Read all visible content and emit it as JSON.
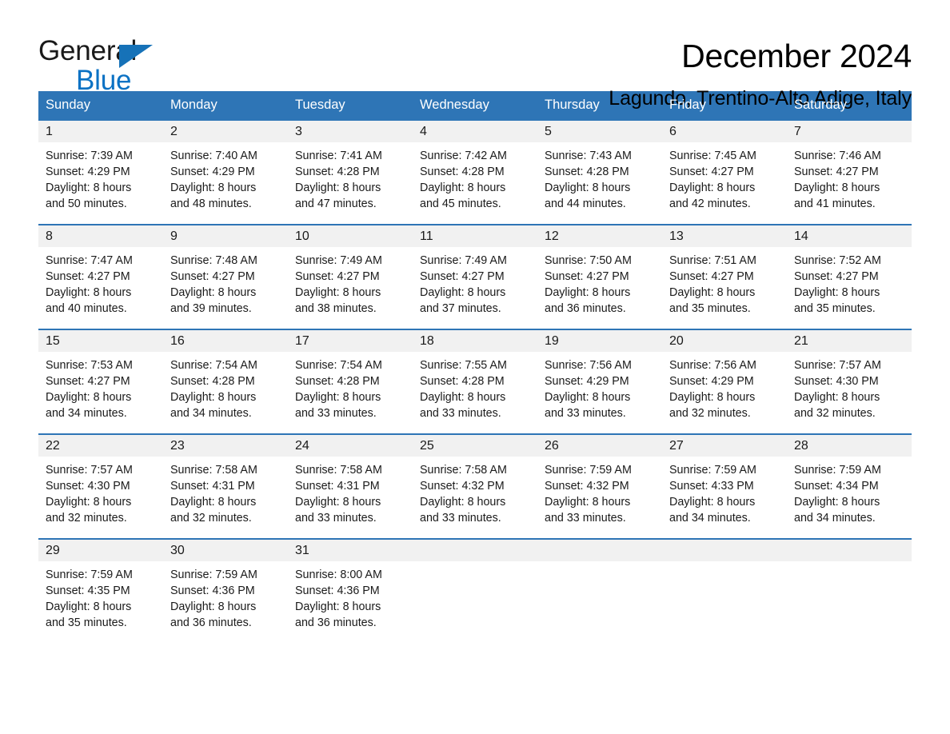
{
  "brand": {
    "name_part1": "General",
    "name_part2": "Blue",
    "triangle_color": "#1672b8",
    "blue_color": "#0b72c4"
  },
  "header": {
    "title": "December 2024",
    "subtitle": "Lagundo, Trentino-Alto Adige, Italy"
  },
  "colors": {
    "header_blue": "#2e75b6",
    "day_band_gray": "#f1f1f1",
    "text": "#1a1a1a"
  },
  "weekday_headers": [
    "Sunday",
    "Monday",
    "Tuesday",
    "Wednesday",
    "Thursday",
    "Friday",
    "Saturday"
  ],
  "weeks": [
    [
      {
        "day": "1",
        "sunrise": "Sunrise: 7:39 AM",
        "sunset": "Sunset: 4:29 PM",
        "daylight1": "Daylight: 8 hours",
        "daylight2": "and 50 minutes."
      },
      {
        "day": "2",
        "sunrise": "Sunrise: 7:40 AM",
        "sunset": "Sunset: 4:29 PM",
        "daylight1": "Daylight: 8 hours",
        "daylight2": "and 48 minutes."
      },
      {
        "day": "3",
        "sunrise": "Sunrise: 7:41 AM",
        "sunset": "Sunset: 4:28 PM",
        "daylight1": "Daylight: 8 hours",
        "daylight2": "and 47 minutes."
      },
      {
        "day": "4",
        "sunrise": "Sunrise: 7:42 AM",
        "sunset": "Sunset: 4:28 PM",
        "daylight1": "Daylight: 8 hours",
        "daylight2": "and 45 minutes."
      },
      {
        "day": "5",
        "sunrise": "Sunrise: 7:43 AM",
        "sunset": "Sunset: 4:28 PM",
        "daylight1": "Daylight: 8 hours",
        "daylight2": "and 44 minutes."
      },
      {
        "day": "6",
        "sunrise": "Sunrise: 7:45 AM",
        "sunset": "Sunset: 4:27 PM",
        "daylight1": "Daylight: 8 hours",
        "daylight2": "and 42 minutes."
      },
      {
        "day": "7",
        "sunrise": "Sunrise: 7:46 AM",
        "sunset": "Sunset: 4:27 PM",
        "daylight1": "Daylight: 8 hours",
        "daylight2": "and 41 minutes."
      }
    ],
    [
      {
        "day": "8",
        "sunrise": "Sunrise: 7:47 AM",
        "sunset": "Sunset: 4:27 PM",
        "daylight1": "Daylight: 8 hours",
        "daylight2": "and 40 minutes."
      },
      {
        "day": "9",
        "sunrise": "Sunrise: 7:48 AM",
        "sunset": "Sunset: 4:27 PM",
        "daylight1": "Daylight: 8 hours",
        "daylight2": "and 39 minutes."
      },
      {
        "day": "10",
        "sunrise": "Sunrise: 7:49 AM",
        "sunset": "Sunset: 4:27 PM",
        "daylight1": "Daylight: 8 hours",
        "daylight2": "and 38 minutes."
      },
      {
        "day": "11",
        "sunrise": "Sunrise: 7:49 AM",
        "sunset": "Sunset: 4:27 PM",
        "daylight1": "Daylight: 8 hours",
        "daylight2": "and 37 minutes."
      },
      {
        "day": "12",
        "sunrise": "Sunrise: 7:50 AM",
        "sunset": "Sunset: 4:27 PM",
        "daylight1": "Daylight: 8 hours",
        "daylight2": "and 36 minutes."
      },
      {
        "day": "13",
        "sunrise": "Sunrise: 7:51 AM",
        "sunset": "Sunset: 4:27 PM",
        "daylight1": "Daylight: 8 hours",
        "daylight2": "and 35 minutes."
      },
      {
        "day": "14",
        "sunrise": "Sunrise: 7:52 AM",
        "sunset": "Sunset: 4:27 PM",
        "daylight1": "Daylight: 8 hours",
        "daylight2": "and 35 minutes."
      }
    ],
    [
      {
        "day": "15",
        "sunrise": "Sunrise: 7:53 AM",
        "sunset": "Sunset: 4:27 PM",
        "daylight1": "Daylight: 8 hours",
        "daylight2": "and 34 minutes."
      },
      {
        "day": "16",
        "sunrise": "Sunrise: 7:54 AM",
        "sunset": "Sunset: 4:28 PM",
        "daylight1": "Daylight: 8 hours",
        "daylight2": "and 34 minutes."
      },
      {
        "day": "17",
        "sunrise": "Sunrise: 7:54 AM",
        "sunset": "Sunset: 4:28 PM",
        "daylight1": "Daylight: 8 hours",
        "daylight2": "and 33 minutes."
      },
      {
        "day": "18",
        "sunrise": "Sunrise: 7:55 AM",
        "sunset": "Sunset: 4:28 PM",
        "daylight1": "Daylight: 8 hours",
        "daylight2": "and 33 minutes."
      },
      {
        "day": "19",
        "sunrise": "Sunrise: 7:56 AM",
        "sunset": "Sunset: 4:29 PM",
        "daylight1": "Daylight: 8 hours",
        "daylight2": "and 33 minutes."
      },
      {
        "day": "20",
        "sunrise": "Sunrise: 7:56 AM",
        "sunset": "Sunset: 4:29 PM",
        "daylight1": "Daylight: 8 hours",
        "daylight2": "and 32 minutes."
      },
      {
        "day": "21",
        "sunrise": "Sunrise: 7:57 AM",
        "sunset": "Sunset: 4:30 PM",
        "daylight1": "Daylight: 8 hours",
        "daylight2": "and 32 minutes."
      }
    ],
    [
      {
        "day": "22",
        "sunrise": "Sunrise: 7:57 AM",
        "sunset": "Sunset: 4:30 PM",
        "daylight1": "Daylight: 8 hours",
        "daylight2": "and 32 minutes."
      },
      {
        "day": "23",
        "sunrise": "Sunrise: 7:58 AM",
        "sunset": "Sunset: 4:31 PM",
        "daylight1": "Daylight: 8 hours",
        "daylight2": "and 32 minutes."
      },
      {
        "day": "24",
        "sunrise": "Sunrise: 7:58 AM",
        "sunset": "Sunset: 4:31 PM",
        "daylight1": "Daylight: 8 hours",
        "daylight2": "and 33 minutes."
      },
      {
        "day": "25",
        "sunrise": "Sunrise: 7:58 AM",
        "sunset": "Sunset: 4:32 PM",
        "daylight1": "Daylight: 8 hours",
        "daylight2": "and 33 minutes."
      },
      {
        "day": "26",
        "sunrise": "Sunrise: 7:59 AM",
        "sunset": "Sunset: 4:32 PM",
        "daylight1": "Daylight: 8 hours",
        "daylight2": "and 33 minutes."
      },
      {
        "day": "27",
        "sunrise": "Sunrise: 7:59 AM",
        "sunset": "Sunset: 4:33 PM",
        "daylight1": "Daylight: 8 hours",
        "daylight2": "and 34 minutes."
      },
      {
        "day": "28",
        "sunrise": "Sunrise: 7:59 AM",
        "sunset": "Sunset: 4:34 PM",
        "daylight1": "Daylight: 8 hours",
        "daylight2": "and 34 minutes."
      }
    ],
    [
      {
        "day": "29",
        "sunrise": "Sunrise: 7:59 AM",
        "sunset": "Sunset: 4:35 PM",
        "daylight1": "Daylight: 8 hours",
        "daylight2": "and 35 minutes."
      },
      {
        "day": "30",
        "sunrise": "Sunrise: 7:59 AM",
        "sunset": "Sunset: 4:36 PM",
        "daylight1": "Daylight: 8 hours",
        "daylight2": "and 36 minutes."
      },
      {
        "day": "31",
        "sunrise": "Sunrise: 8:00 AM",
        "sunset": "Sunset: 4:36 PM",
        "daylight1": "Daylight: 8 hours",
        "daylight2": "and 36 minutes."
      },
      {
        "day": "",
        "sunrise": "",
        "sunset": "",
        "daylight1": "",
        "daylight2": ""
      },
      {
        "day": "",
        "sunrise": "",
        "sunset": "",
        "daylight1": "",
        "daylight2": ""
      },
      {
        "day": "",
        "sunrise": "",
        "sunset": "",
        "daylight1": "",
        "daylight2": ""
      },
      {
        "day": "",
        "sunrise": "",
        "sunset": "",
        "daylight1": "",
        "daylight2": ""
      }
    ]
  ]
}
